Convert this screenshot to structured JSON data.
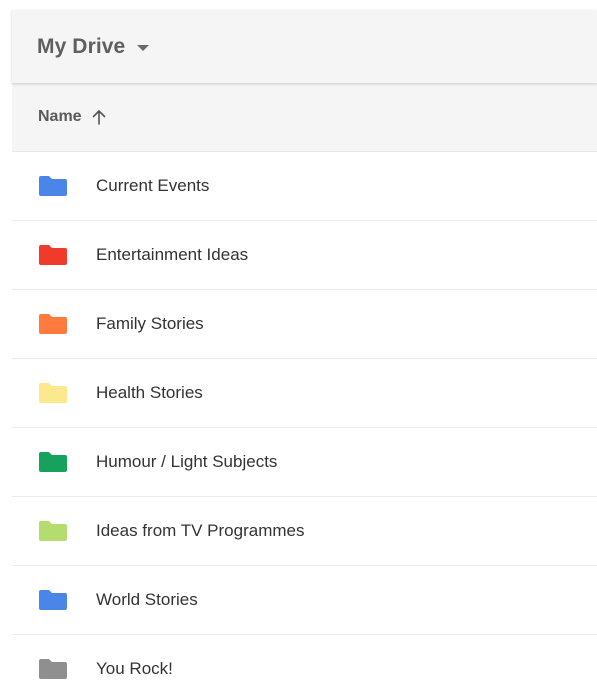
{
  "header": {
    "title": "My Drive",
    "dropdown_icon": "caret-down-icon"
  },
  "column_header": {
    "label": "Name",
    "sort_icon": "arrow-up-icon"
  },
  "folders": [
    {
      "name": "Current Events",
      "color": "#4a86e8",
      "icon": "folder-icon"
    },
    {
      "name": "Entertainment Ideas",
      "color": "#f03b2a",
      "icon": "folder-icon"
    },
    {
      "name": "Family Stories",
      "color": "#ff7a3d",
      "icon": "folder-icon"
    },
    {
      "name": "Health Stories",
      "color": "#fce98e",
      "icon": "folder-icon"
    },
    {
      "name": "Humour / Light Subjects",
      "color": "#16a15c",
      "icon": "folder-icon"
    },
    {
      "name": "Ideas from TV Programmes",
      "color": "#b5dc6e",
      "icon": "folder-icon"
    },
    {
      "name": "World Stories",
      "color": "#4a86e8",
      "icon": "folder-icon"
    },
    {
      "name": "You Rock!",
      "color": "#8f8f8f",
      "icon": "folder-icon"
    }
  ]
}
